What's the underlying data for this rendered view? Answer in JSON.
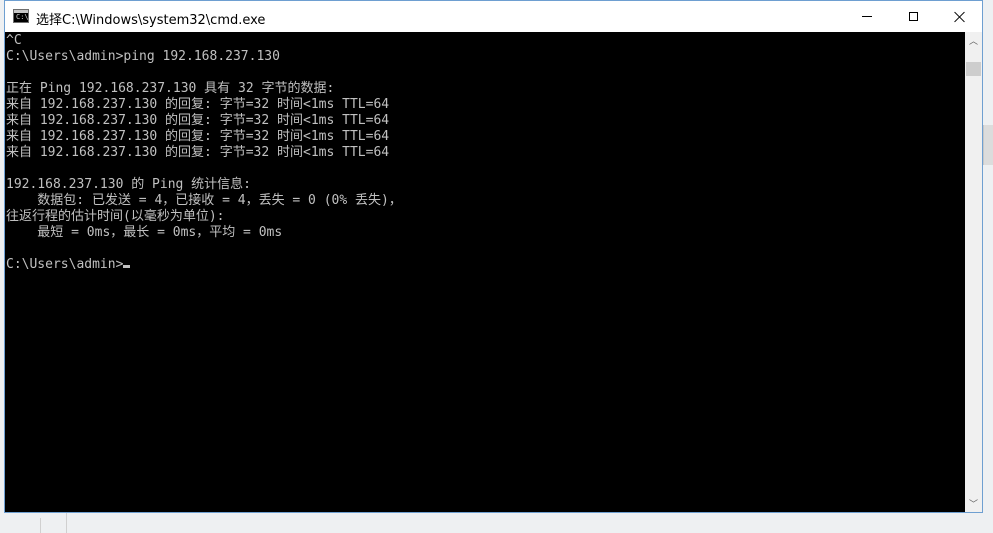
{
  "window": {
    "title": "选择C:\\Windows\\system32\\cmd.exe",
    "icon": "cmd-icon",
    "icon_text": "C:\\"
  },
  "controls": {
    "minimize": "minimize-icon",
    "maximize": "maximize-icon",
    "close": "close-icon"
  },
  "console": {
    "lines": [
      "^C",
      "C:\\Users\\admin>ping 192.168.237.130",
      "",
      "正在 Ping 192.168.237.130 具有 32 字节的数据:",
      "来自 192.168.237.130 的回复: 字节=32 时间<1ms TTL=64",
      "来自 192.168.237.130 的回复: 字节=32 时间<1ms TTL=64",
      "来自 192.168.237.130 的回复: 字节=32 时间<1ms TTL=64",
      "来自 192.168.237.130 的回复: 字节=32 时间<1ms TTL=64",
      "",
      "192.168.237.130 的 Ping 统计信息:",
      "    数据包: 已发送 = 4，已接收 = 4，丢失 = 0 (0% 丢失)，",
      "往返行程的估计时间(以毫秒为单位):",
      "    最短 = 0ms，最长 = 0ms，平均 = 0ms",
      "",
      "C:\\Users\\admin>"
    ],
    "foreground": "#c0c0c0",
    "background": "#000000"
  },
  "scrollbar": {
    "up": "chevron-up-icon",
    "down": "chevron-down-icon"
  }
}
